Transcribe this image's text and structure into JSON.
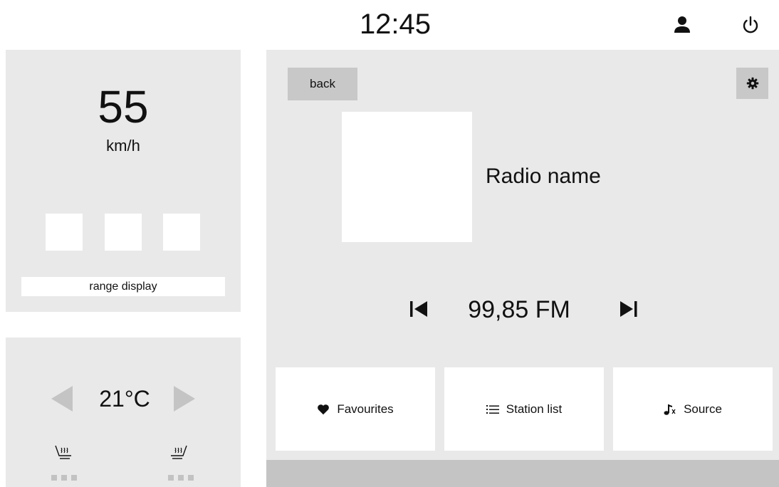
{
  "status_bar": {
    "time": "12:45",
    "icons": [
      "user-icon",
      "power-icon"
    ]
  },
  "speed_panel": {
    "speed": "55",
    "unit": "km/h",
    "range_label": "range display"
  },
  "climate_panel": {
    "temperature": "21°C",
    "icons": [
      "chevron-left-icon",
      "chevron-right-icon",
      "seat-heat-left-icon",
      "seat-heat-right-icon"
    ]
  },
  "radio": {
    "back_label": "back",
    "station_name": "Radio name",
    "frequency": "99,85 FM",
    "icons": [
      "settings-gear-icon",
      "skip-previous-icon",
      "skip-next-icon"
    ]
  },
  "bottom_nav": [
    {
      "label": "Favourites",
      "icon": "heart-icon"
    },
    {
      "label": "Station list",
      "icon": "list-icon"
    },
    {
      "label": "Source",
      "icon": "music-source-icon"
    }
  ],
  "colors": {
    "panel_bg": "#e9e9e9",
    "button_gray": "#c8c8c8",
    "text": "#111111",
    "indicator_gray": "#c2c2c2"
  }
}
